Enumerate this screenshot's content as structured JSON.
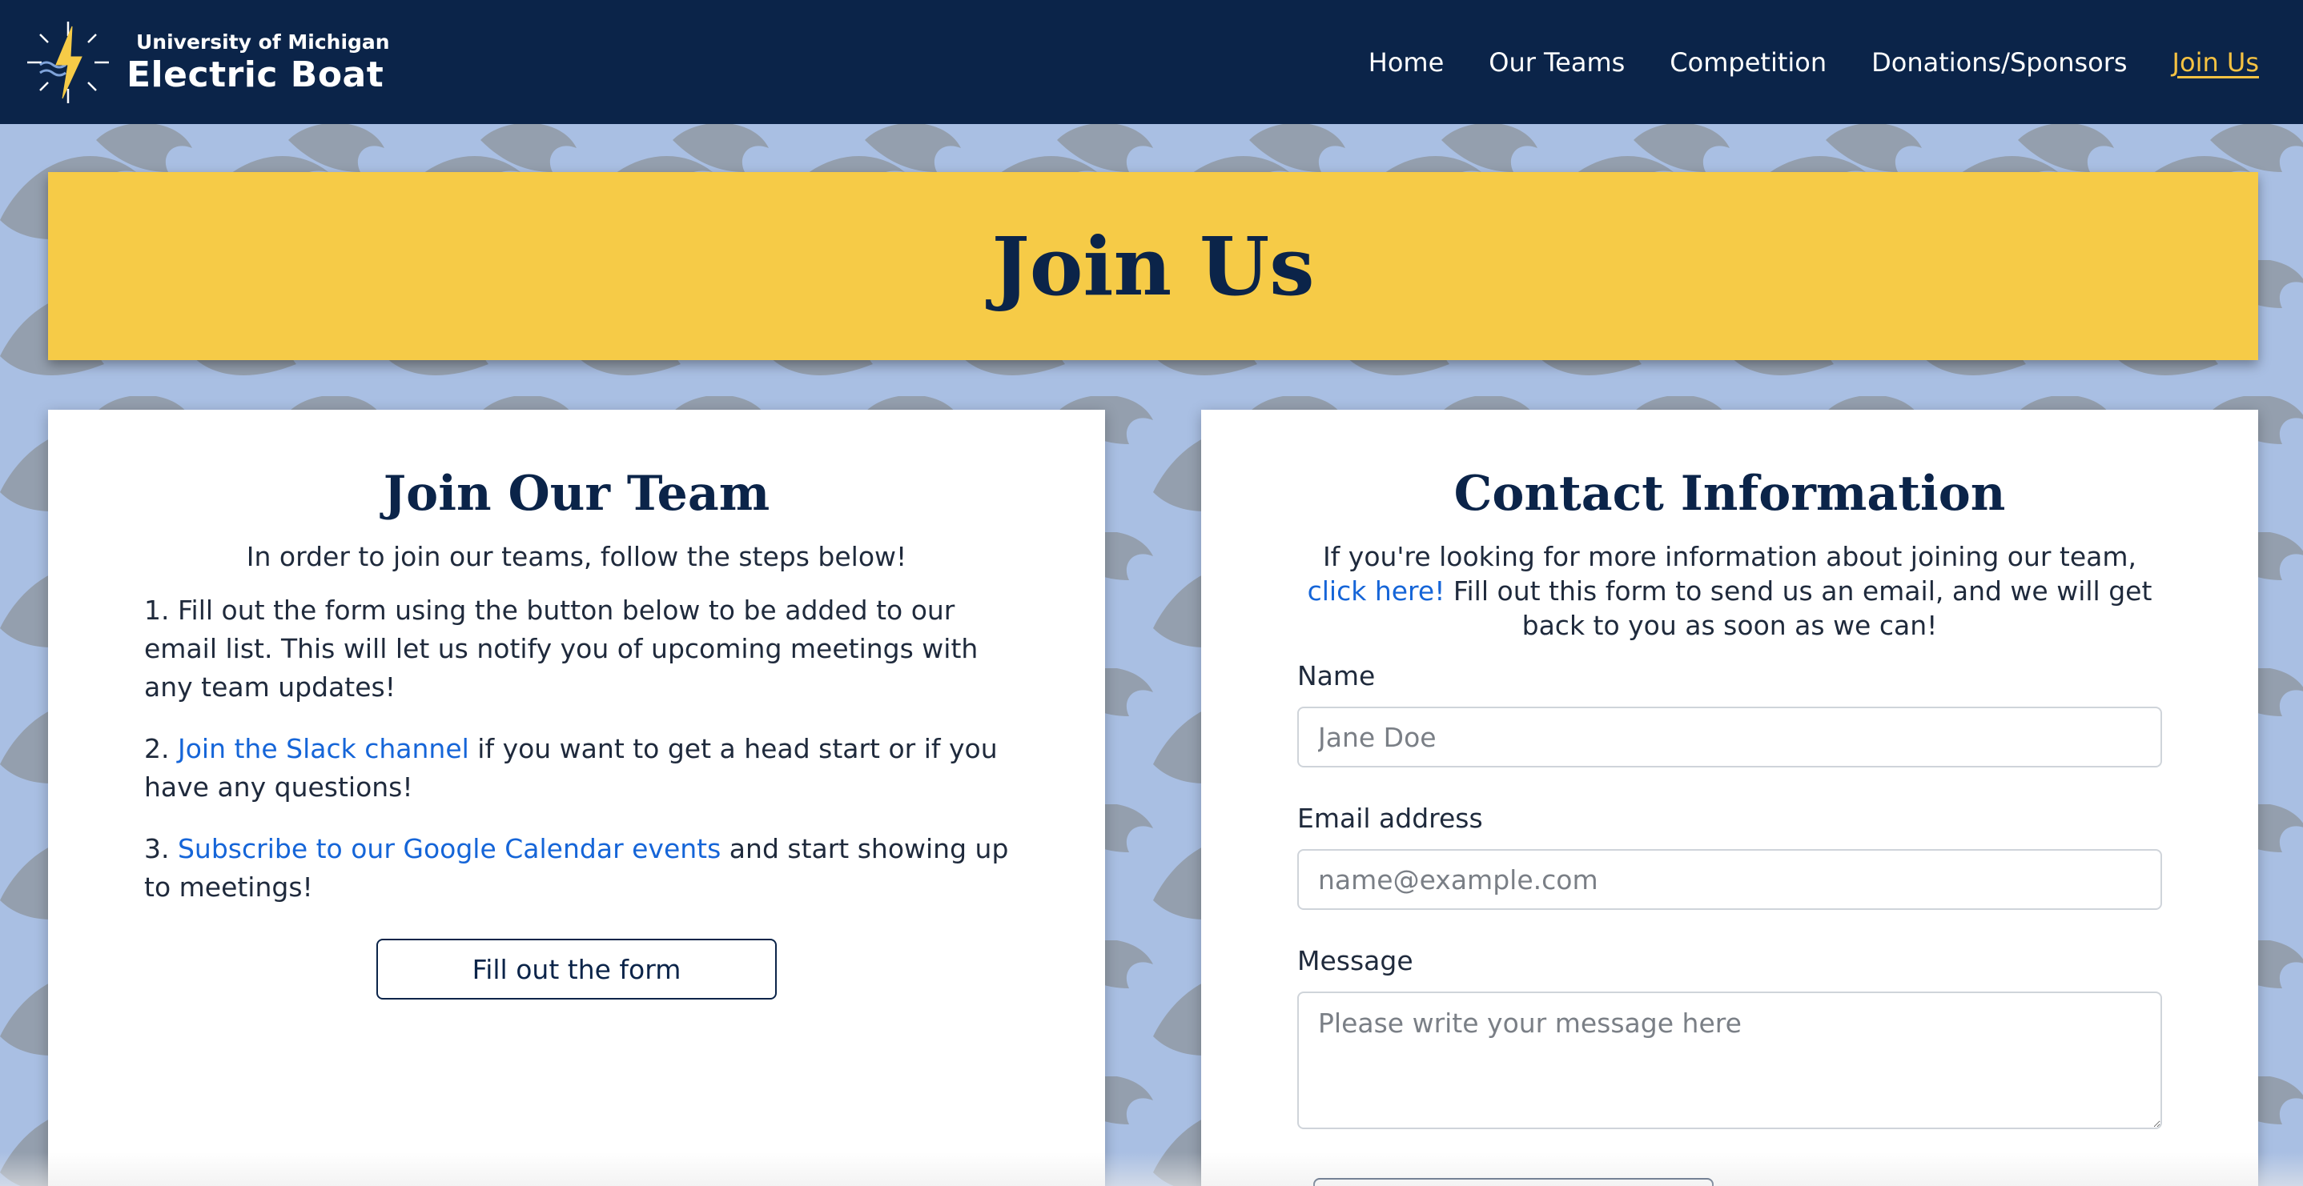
{
  "brand": {
    "subtitle": "University of Michigan",
    "title": "Electric Boat",
    "logo_icon": "lightning-compass-logo-icon"
  },
  "nav": {
    "items": [
      {
        "label": "Home"
      },
      {
        "label": "Our Teams"
      },
      {
        "label": "Competition"
      },
      {
        "label": "Donations/Sponsors"
      },
      {
        "label": "Join Us",
        "active": true
      }
    ]
  },
  "banner": {
    "title": "Join Us"
  },
  "join": {
    "heading": "Join Our Team",
    "intro": "In order to join our teams, follow the steps below!",
    "step1": "1. Fill out the form using the button below to be added to our email list. This will let us notify you of upcoming meetings with any team updates!",
    "step2_prefix": "2. ",
    "step2_link": "Join the Slack channel",
    "step2_suffix": " if you want to get a head start or if you have any questions!",
    "step3_prefix": "3. ",
    "step3_link": "Subscribe to our Google Calendar events",
    "step3_suffix": " and start showing up to meetings!",
    "button_label": "Fill out the form"
  },
  "contact": {
    "heading": "Contact Information",
    "lead_prefix": "If you're looking for more information about joining our team, ",
    "lead_link": "click here!",
    "lead_suffix": " Fill out this form to send us an email, and we will get back to you as soon as we can!",
    "name_label": "Name",
    "name_placeholder": "Jane Doe",
    "email_label": "Email address",
    "email_placeholder": "name@example.com",
    "message_label": "Message",
    "message_placeholder": "Please write your message here"
  },
  "colors": {
    "navbar": "#0b2449",
    "accent_yellow": "#f6cb47",
    "active_link": "#f5c242",
    "link_blue": "#1565d8",
    "background_blue": "#a9bfe3"
  }
}
